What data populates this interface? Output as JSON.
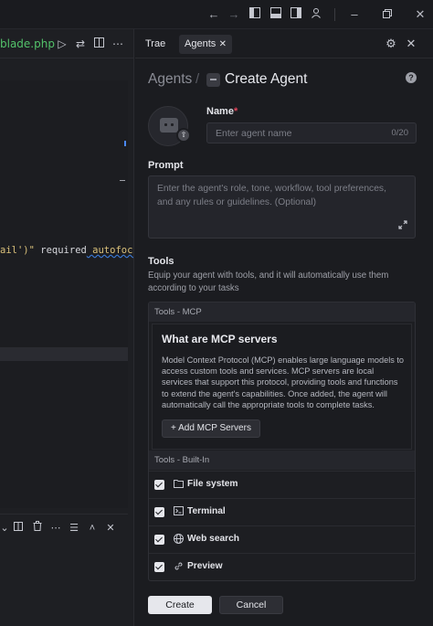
{
  "window": {
    "controls": [
      "back-icon",
      "forward-icon",
      "layout-left-icon",
      "layout-bottom-icon",
      "layout-right-icon",
      "account-icon",
      "minimize-icon",
      "restore-icon",
      "close-icon"
    ]
  },
  "editor": {
    "file_tab": "blade.php",
    "code_text_a": "ail')\" ",
    "code_keyword": "required",
    "code_text_b": " autofocu"
  },
  "agent_panel": {
    "tabs": [
      {
        "label": "Trae"
      },
      {
        "label": "Agents",
        "close": "✕"
      }
    ],
    "breadcrumb": {
      "parent": "Agents",
      "separator": "/",
      "title": "Create Agent"
    },
    "help": "?",
    "name": {
      "label": "Name",
      "required_mark": "*",
      "placeholder": "Enter agent name",
      "counter": "0/20"
    },
    "prompt": {
      "label": "Prompt",
      "placeholder": "Enter the agent's role, tone, workflow, tool preferences, and any rules or guidelines. (Optional)"
    },
    "tools": {
      "label": "Tools",
      "description": "Equip your agent with tools, and it will automatically use them according to your tasks",
      "mcp_header": "Tools - MCP",
      "mcp_title": "What are MCP servers",
      "mcp_text": "Model Context Protocol (MCP) enables large language models to access custom tools and services. MCP servers are local services that support this protocol, providing tools and functions to extend the agent's capabilities. Once added, the agent will automatically call the appropriate tools to complete tasks.",
      "add_button": "+  Add MCP Servers",
      "builtin_header": "Tools - Built-In",
      "builtin": [
        {
          "label": "File system",
          "icon": "folder-icon",
          "checked": true
        },
        {
          "label": "Terminal",
          "icon": "terminal-icon",
          "checked": true
        },
        {
          "label": "Web search",
          "icon": "globe-icon",
          "checked": true
        },
        {
          "label": "Preview",
          "icon": "link-icon",
          "checked": true
        }
      ]
    },
    "actions": {
      "create": "Create",
      "cancel": "Cancel"
    }
  }
}
